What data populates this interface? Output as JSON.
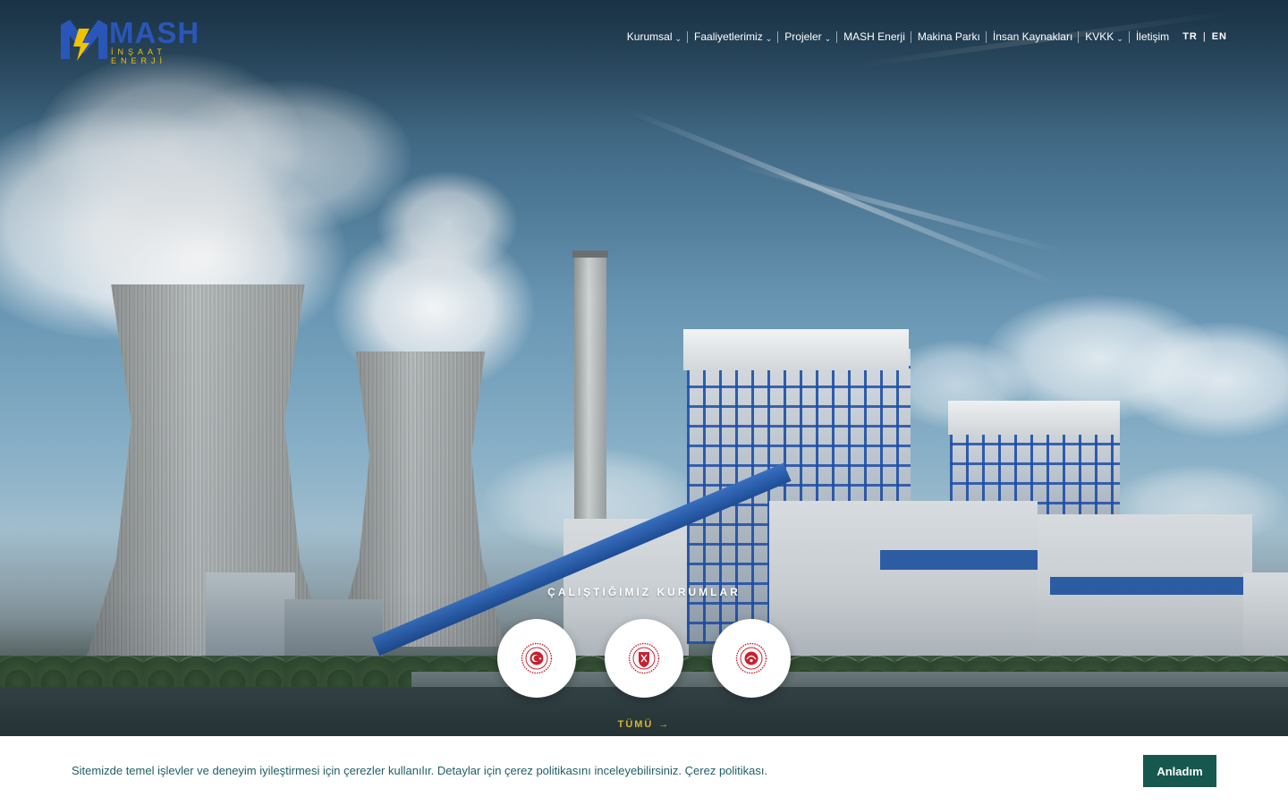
{
  "brand": {
    "name": "MASH",
    "tagline": "İNŞAAT ENERJİ",
    "primary_color": "#2a56b8",
    "accent_color": "#f2c200"
  },
  "nav": {
    "items": [
      {
        "label": "Kurumsal",
        "has_dropdown": true
      },
      {
        "label": "Faaliyetlerimiz",
        "has_dropdown": true
      },
      {
        "label": "Projeler",
        "has_dropdown": true
      },
      {
        "label": "MASH Enerji",
        "has_dropdown": false
      },
      {
        "label": "Makina Parkı",
        "has_dropdown": false
      },
      {
        "label": "İnsan Kaynakları",
        "has_dropdown": false
      },
      {
        "label": "KVKK",
        "has_dropdown": true
      },
      {
        "label": "İletişim",
        "has_dropdown": false
      }
    ],
    "languages": {
      "tr": "TR",
      "separator": "|",
      "en": "EN"
    }
  },
  "hero": {
    "image_subject": "power-plant-with-cooling-towers"
  },
  "partners": {
    "title": "ÇALIŞTIĞIMIZ KURUMLAR",
    "items": [
      {
        "icon": "government-seal-icon",
        "color": "#c8202f"
      },
      {
        "icon": "government-seal-icon",
        "color": "#c8202f"
      },
      {
        "icon": "government-seal-icon",
        "color": "#c8202f"
      }
    ],
    "all_link": "TÜMÜ",
    "all_link_arrow": "→",
    "link_color": "#d9b527"
  },
  "cookie": {
    "text": "Sitemizde temel işlevler ve deneyim iyileştirmesi için çerezler kullanılır. Detaylar için çerez politikasını inceleyebilirsiniz.",
    "policy_link": "Çerez politikası.",
    "button": "Anladım",
    "button_color": "#16584d"
  }
}
